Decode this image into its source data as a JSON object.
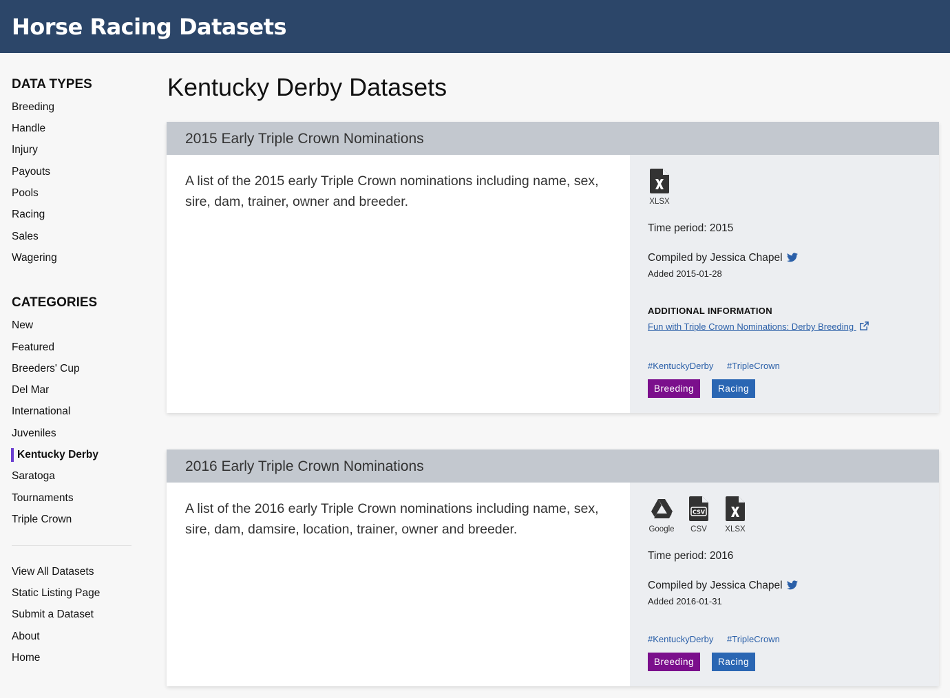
{
  "site": {
    "title": "Horse Racing Datasets"
  },
  "sidebar": {
    "data_types_heading": "DATA TYPES",
    "data_types": [
      "Breeding",
      "Handle",
      "Injury",
      "Payouts",
      "Pools",
      "Racing",
      "Sales",
      "Wagering"
    ],
    "categories_heading": "CATEGORIES",
    "categories": [
      "New",
      "Featured",
      "Breeders' Cup",
      "Del Mar",
      "International",
      "Juveniles",
      "Kentucky Derby",
      "Saratoga",
      "Tournaments",
      "Triple Crown"
    ],
    "active_category": "Kentucky Derby",
    "footer_links": [
      "View All Datasets",
      "Static Listing Page",
      "Submit a Dataset",
      "About",
      "Home"
    ]
  },
  "main": {
    "page_title": "Kentucky Derby Datasets",
    "cards": [
      {
        "title": "2015 Early Triple Crown Nominations",
        "description": "A list of the 2015 early Triple Crown nominations including name, sex, sire, dam, trainer, owner and breeder.",
        "formats": [
          "XLSX"
        ],
        "time_period": "Time period: 2015",
        "compiled_by": "Compiled by Jessica Chapel",
        "added": "Added 2015-01-28",
        "additional_heading": "ADDITIONAL INFORMATION",
        "additional_link": "Fun with Triple Crown Nominations: Derby Breeding",
        "hashtags": [
          "#KentuckyDerby",
          "#TripleCrown"
        ],
        "badges": [
          "Breeding",
          "Racing"
        ]
      },
      {
        "title": "2016 Early Triple Crown Nominations",
        "description": "A list of the 2016 early Triple Crown nominations including name, sex, sire, dam, damsire, location, trainer, owner and breeder.",
        "formats": [
          "Google",
          "CSV",
          "XLSX"
        ],
        "time_period": "Time period: 2016",
        "compiled_by": "Compiled by Jessica Chapel",
        "added": "Added 2016-01-31",
        "hashtags": [
          "#KentuckyDerby",
          "#TripleCrown"
        ],
        "badges": [
          "Breeding",
          "Racing"
        ]
      }
    ]
  },
  "colors": {
    "topbar": "#2c4669",
    "card_header": "#c3c8cf",
    "card_side": "#eceef1",
    "active_marker": "#6b3fd0",
    "badge_breeding": "#7b0f8c",
    "badge_racing": "#2a66b3",
    "link": "#2a5fa8",
    "twitter": "#2a5fa8"
  },
  "icons": {
    "xlsx": "xlsx-file-icon",
    "csv": "csv-file-icon",
    "google": "google-drive-icon",
    "twitter": "twitter-icon",
    "external": "external-link-icon"
  }
}
